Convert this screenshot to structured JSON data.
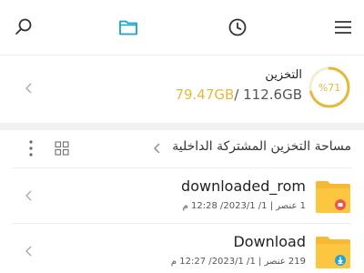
{
  "topbar": {
    "icons": [
      "search-icon",
      "folder-icon",
      "clock-icon",
      "menu-icon"
    ],
    "accent": "#1aa3c8"
  },
  "storage": {
    "title": "التخزين",
    "used": "79.47GB",
    "total": "/ 112.6GB",
    "percent_label": "%71",
    "fraction": 0.71,
    "accent": "#e5b93a"
  },
  "path": {
    "label": "مساحة التخزين المشتركة الداخلية"
  },
  "files": [
    {
      "name": "downloaded_rom",
      "meta": "1 عنصر | 1/ 2023/1/ 12:28 م",
      "badge_icon": "app-badge-icon",
      "badge_color": "#e8584c"
    },
    {
      "name": "Download",
      "meta": "219 عنصر | 1/ 2023/1/ 12:27 م",
      "badge_icon": "download-badge-icon",
      "badge_color": "#2aa4d8"
    }
  ]
}
